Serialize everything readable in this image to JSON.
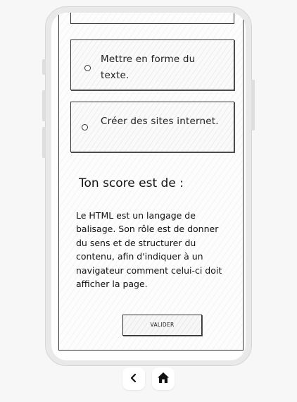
{
  "quiz": {
    "options": [
      {
        "label_line1": "Mettre en forme du",
        "label_line2": "texte."
      },
      {
        "label": "Créer des sites internet."
      }
    ],
    "score_label": "Ton score est de :",
    "description": "Le HTML est un langage de balisage. Son rôle est de donner du sens et de structurer du contenu, afin d'indiquer à un navigateur comment celui-ci doit afficher la page.",
    "validate_label": "VALIDER"
  },
  "nav": {
    "back_icon": "chevron-left-icon",
    "home_icon": "home-icon"
  }
}
